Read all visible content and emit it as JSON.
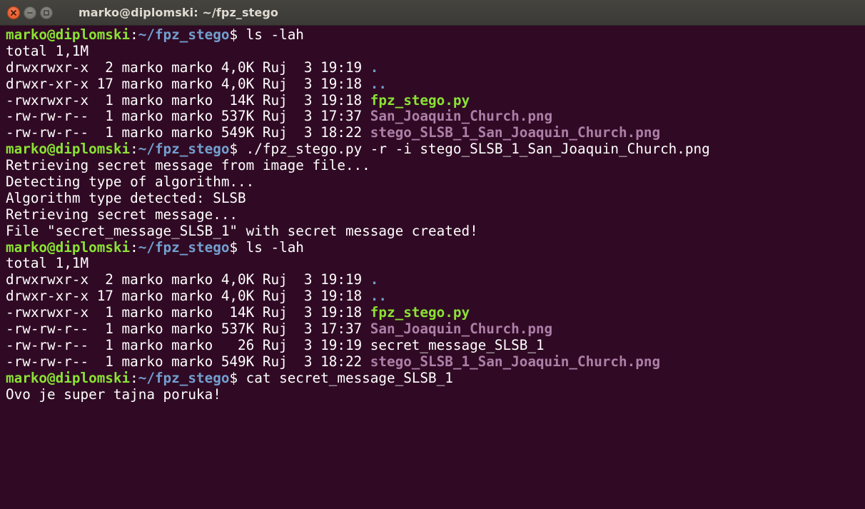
{
  "window": {
    "title": "marko@diplomski: ~/fpz_stego"
  },
  "prompt": {
    "user_host": "marko@diplomski",
    "sep": ":",
    "path": "~/fpz_stego",
    "dollar": "$ "
  },
  "colors": {
    "background": "#300a24",
    "prompt_user": "#8ae234",
    "prompt_path": "#729fcf",
    "directory": "#729fcf",
    "executable": "#8ae234",
    "image": "#ad7fa8",
    "text": "#ffffff",
    "close_button": "#e95420"
  },
  "lines": [
    {
      "type": "prompt",
      "cmd": "ls -lah"
    },
    {
      "type": "out",
      "text": "total 1,1M"
    },
    {
      "type": "ls",
      "meta": "drwxrwxr-x  2 marko marko 4,0K Ruj  3 19:19 ",
      "name": ".",
      "kind": "dir"
    },
    {
      "type": "ls",
      "meta": "drwxr-xr-x 17 marko marko 4,0K Ruj  3 19:18 ",
      "name": "..",
      "kind": "dir"
    },
    {
      "type": "ls",
      "meta": "-rwxrwxr-x  1 marko marko  14K Ruj  3 19:18 ",
      "name": "fpz_stego.py",
      "kind": "exe"
    },
    {
      "type": "ls",
      "meta": "-rw-rw-r--  1 marko marko 537K Ruj  3 17:37 ",
      "name": "San_Joaquin_Church.png",
      "kind": "img"
    },
    {
      "type": "ls",
      "meta": "-rw-rw-r--  1 marko marko 549K Ruj  3 18:22 ",
      "name": "stego_SLSB_1_San_Joaquin_Church.png",
      "kind": "img"
    },
    {
      "type": "prompt",
      "cmd": "./fpz_stego.py -r -i stego_SLSB_1_San_Joaquin_Church.png"
    },
    {
      "type": "out",
      "text": "Retrieving secret message from image file..."
    },
    {
      "type": "out",
      "text": "Detecting type of algorithm..."
    },
    {
      "type": "out",
      "text": "Algorithm type detected: SLSB"
    },
    {
      "type": "out",
      "text": "Retrieving secret message..."
    },
    {
      "type": "out",
      "text": "File \"secret_message_SLSB_1\" with secret message created!"
    },
    {
      "type": "prompt",
      "cmd": "ls -lah"
    },
    {
      "type": "out",
      "text": "total 1,1M"
    },
    {
      "type": "ls",
      "meta": "drwxrwxr-x  2 marko marko 4,0K Ruj  3 19:19 ",
      "name": ".",
      "kind": "dir"
    },
    {
      "type": "ls",
      "meta": "drwxr-xr-x 17 marko marko 4,0K Ruj  3 19:18 ",
      "name": "..",
      "kind": "dir"
    },
    {
      "type": "ls",
      "meta": "-rwxrwxr-x  1 marko marko  14K Ruj  3 19:18 ",
      "name": "fpz_stego.py",
      "kind": "exe"
    },
    {
      "type": "ls",
      "meta": "-rw-rw-r--  1 marko marko 537K Ruj  3 17:37 ",
      "name": "San_Joaquin_Church.png",
      "kind": "img"
    },
    {
      "type": "ls",
      "meta": "-rw-rw-r--  1 marko marko   26 Ruj  3 19:19 ",
      "name": "secret_message_SLSB_1",
      "kind": "plain"
    },
    {
      "type": "ls",
      "meta": "-rw-rw-r--  1 marko marko 549K Ruj  3 18:22 ",
      "name": "stego_SLSB_1_San_Joaquin_Church.png",
      "kind": "img"
    },
    {
      "type": "prompt",
      "cmd": "cat secret_message_SLSB_1"
    },
    {
      "type": "out",
      "text": "Ovo je super tajna poruka!"
    }
  ]
}
